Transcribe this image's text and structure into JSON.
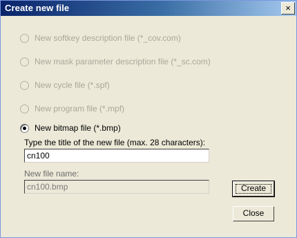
{
  "window": {
    "title": "Create new file",
    "close_glyph": "×"
  },
  "options": [
    {
      "label": "New softkey description file (*_cov.com)",
      "enabled": false,
      "selected": false
    },
    {
      "label": "New mask parameter description file (*_sc.com)",
      "enabled": false,
      "selected": false
    },
    {
      "label": "New cycle file (*.spf)",
      "enabled": false,
      "selected": false
    },
    {
      "label": "New program file (*.mpf)",
      "enabled": false,
      "selected": false
    },
    {
      "label": "New bitmap file (*.bmp)",
      "enabled": true,
      "selected": true
    }
  ],
  "title_prompt": "Type the title of the new file (max. 28 characters):",
  "title_input": {
    "value": "cn100"
  },
  "new_name": {
    "label": "New file name:",
    "value": "cn100.bmp"
  },
  "buttons": {
    "create": "Create",
    "close": "Close"
  }
}
